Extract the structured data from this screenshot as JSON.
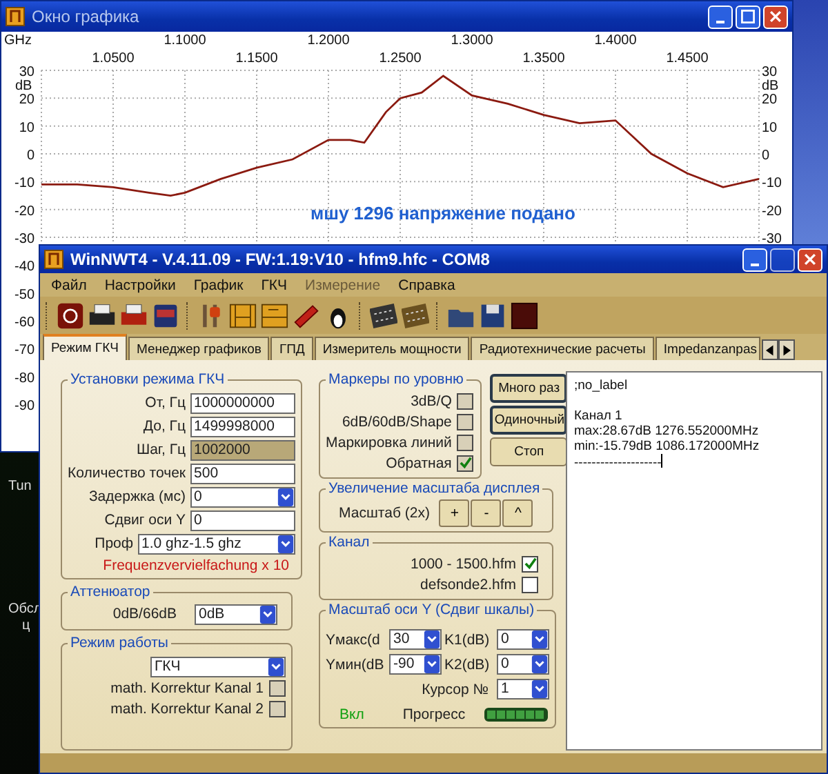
{
  "desktop": {
    "labels": [
      "Tun",
      "Обсл",
      "ц"
    ]
  },
  "graph_window": {
    "title": "Окно графика",
    "right_axis": {
      "unit": "dB",
      "labels": [
        "30",
        "20",
        "10",
        "0",
        "-10",
        "-20",
        "-30"
      ]
    },
    "top_axis": {
      "labels": [
        "1.1000",
        "1.2000",
        "1.3000",
        "1.4000"
      ]
    },
    "chart_data": {
      "type": "line",
      "xlabel": "GHz",
      "ylabel": "dB",
      "xlim": [
        1.0,
        1.5
      ],
      "ylim": [
        -90,
        30
      ],
      "grid": true,
      "xticks": [
        {
          "value": 1.05,
          "label": "1.0500"
        },
        {
          "value": 1.15,
          "label": "1.1500"
        },
        {
          "value": 1.25,
          "label": "1.2500"
        },
        {
          "value": 1.35,
          "label": "1.3500"
        },
        {
          "value": 1.45,
          "label": "1.4500"
        }
      ],
      "yticks": [
        30,
        20,
        10,
        0,
        -10,
        -20,
        -30,
        -40,
        -50,
        -60,
        -70,
        -80,
        -90
      ],
      "x": [
        1.0,
        1.025,
        1.05,
        1.075,
        1.09,
        1.1,
        1.125,
        1.15,
        1.175,
        1.2,
        1.215,
        1.225,
        1.24,
        1.25,
        1.265,
        1.28,
        1.3,
        1.325,
        1.35,
        1.375,
        1.4,
        1.425,
        1.45,
        1.475,
        1.5
      ],
      "series": [
        {
          "color": "#8b1a10",
          "values": [
            -11,
            -11,
            -12,
            -14,
            -15,
            -14,
            -9,
            -5,
            -2,
            5,
            5,
            4,
            15,
            20,
            22,
            28,
            21,
            18,
            14,
            11,
            12,
            0,
            -7,
            -12,
            -9
          ]
        }
      ],
      "annotations": [
        {
          "text": "мшу 1296 напряжение подано"
        }
      ]
    }
  },
  "main_window": {
    "title": "WinNWT4 - V.4.11.09 - FW:1.19:V10 - hfm9.hfc - COM8",
    "menu": [
      "Файл",
      "Настройки",
      "График",
      "ГКЧ",
      "Измерение",
      "Справка"
    ],
    "tabs": [
      {
        "label": "Режим ГКЧ",
        "selected": true
      },
      {
        "label": "Менеджер графиков",
        "selected": false
      },
      {
        "label": "ГПД",
        "selected": false
      },
      {
        "label": "Измеритель мощности",
        "selected": false
      },
      {
        "label": "Радиотехнические расчеты",
        "selected": false
      },
      {
        "label": "Impedanzanpas",
        "selected": false
      }
    ],
    "sweep_settings": {
      "title": "Установки режима ГКЧ",
      "fields": [
        {
          "label": "От, Гц",
          "value": "1000000000",
          "kind": "input"
        },
        {
          "label": "До, Гц",
          "value": "1499998000",
          "kind": "input"
        },
        {
          "label": "Шаг, Гц",
          "value": "1002000",
          "kind": "readonly"
        },
        {
          "label": "Количество точек",
          "value": "500",
          "kind": "input"
        },
        {
          "label": "Задержка (мс)",
          "value": "0",
          "kind": "select"
        },
        {
          "label": "Сдвиг оси Y",
          "value": "0",
          "kind": "input"
        },
        {
          "label": "Проф",
          "value": "1.0 ghz-1.5 ghz",
          "kind": "wide-select"
        }
      ],
      "note": "Frequenzvervielfachung x 10"
    },
    "attenuator": {
      "title": "Аттенюатор",
      "label": "0dB/66dB",
      "value": "0dB"
    },
    "mode": {
      "title": "Режим работы",
      "value": "ГКЧ",
      "options": [
        {
          "label": "math. Korrektur Kanal 1",
          "checked": false
        },
        {
          "label": "math. Korrektur Kanal 2",
          "checked": false
        }
      ]
    },
    "markers": {
      "title": "Маркеры по уровню",
      "items": [
        {
          "label": "3dB/Q",
          "checked": false
        },
        {
          "label": "6dB/60dB/Shape",
          "checked": false
        },
        {
          "label": "Маркировка линий",
          "checked": false
        },
        {
          "label": "Обратная",
          "checked": true
        }
      ]
    },
    "buttons": [
      "Много раз",
      "Одиночный",
      "Стоп"
    ],
    "zoom": {
      "title": "Увеличение масштаба дисплея",
      "label": "Масштаб (2x)",
      "buttons": [
        "+",
        "-",
        "^"
      ]
    },
    "channel": {
      "title": "Канал",
      "items": [
        {
          "label": "1000 - 1500.hfm",
          "checked": true
        },
        {
          "label": "defsonde2.hfm",
          "checked": false
        }
      ]
    },
    "y_scale": {
      "title": "Масштаб оси Y (Сдвиг шкалы)",
      "fields": [
        {
          "label": "Yмакс(d",
          "value": "30"
        },
        {
          "label": "K1(dB)",
          "value": "0"
        },
        {
          "label": "Yмин(dB",
          "value": "-90"
        },
        {
          "label": "K2(dB)",
          "value": "0"
        }
      ],
      "cursor": {
        "label": "Курсор №",
        "value": "1"
      },
      "status": "Вкл",
      "progress_label": "Прогресс",
      "level": 1
    },
    "output": ";no_label\n\nКанал 1\nmax:28.67dB 1276.552000MHz\nmin:-15.79dB 1086.172000MHz\n--------------------"
  }
}
